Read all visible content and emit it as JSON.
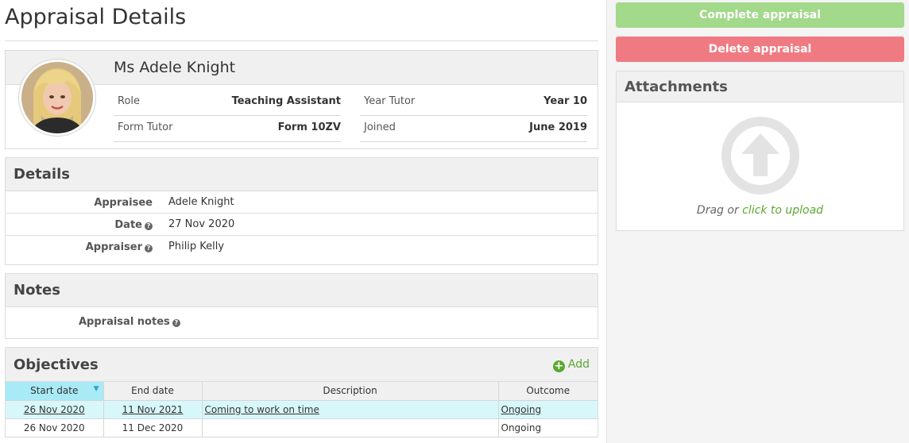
{
  "page": {
    "title": "Appraisal Details"
  },
  "profile": {
    "name": "Ms Adele Knight",
    "fields": [
      {
        "label": "Role",
        "value": "Teaching Assistant"
      },
      {
        "label": "Year Tutor",
        "value": "Year 10"
      },
      {
        "label": "Form Tutor",
        "value": "Form 10ZV"
      },
      {
        "label": "Joined",
        "value": "June 2019"
      }
    ]
  },
  "details": {
    "heading": "Details",
    "rows": [
      {
        "label": "Appraisee",
        "value": "Adele Knight",
        "help": false
      },
      {
        "label": "Date",
        "value": "27 Nov 2020",
        "help": true
      },
      {
        "label": "Appraiser",
        "value": "Philip Kelly",
        "help": true
      }
    ]
  },
  "notes": {
    "heading": "Notes",
    "label": "Appraisal notes"
  },
  "objectives": {
    "heading": "Objectives",
    "add_label": "Add",
    "columns": [
      "Start date",
      "End date",
      "Description",
      "Outcome"
    ],
    "rows": [
      {
        "start": "26 Nov 2020",
        "end": "11 Nov 2021",
        "description": "Coming to work on time",
        "outcome": "Ongoing"
      },
      {
        "start": "26 Nov 2020",
        "end": "11 Dec 2020",
        "description": "",
        "outcome": "Ongoing"
      }
    ]
  },
  "actions": {
    "complete_label": "Complete appraisal",
    "delete_label": "Delete appraisal"
  },
  "attachments": {
    "heading": "Attachments",
    "drag_text": "Drag or",
    "upload_link": "click to upload"
  },
  "colors": {
    "complete": "#a2d98a",
    "delete": "#f07a82",
    "link": "#5aa830",
    "highlight": "#d7f7fb"
  }
}
